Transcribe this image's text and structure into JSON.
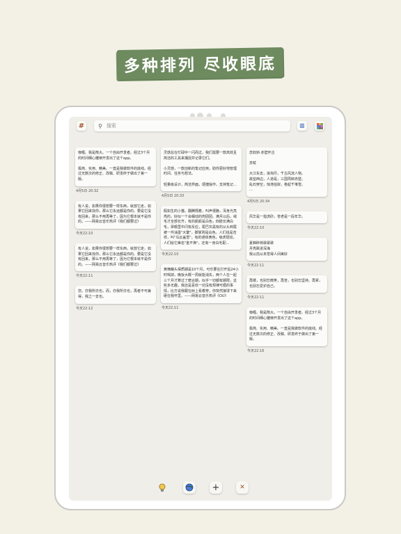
{
  "headline": "多种排列 尽收眼底",
  "search": {
    "placeholder": "搜索"
  },
  "toolbar": {
    "tag_icon": "#",
    "sort_icon": "≡",
    "color_icon": "■"
  },
  "columns": [
    [
      {
        "text": "咖喱。我是熊大。一个自由开发者。经过3个月的时间细心雕琢开发出了这个app。\n\n极简、实用、精美。一直是我做软件的底线。经过无数次的修正、改稿、研发终于做出了第一版。",
        "time": "4月5日 20:32"
      },
      {
        "text": "有人说，如果你很想要一样东西，就放它走，如果它回来找你，那么它永远都是你的。要是它没有回来，那么不用再等了，因为它根本就不是你的。——网易云音乐热评《我们都要过》",
        "time": "今天22:10"
      },
      {
        "text": "有人说，如果你很想要一样东西，就放它走，如果它回来找你，那么它永远都是你的。要是它没有回来，那么不用再等了，因为它根本就不是你的。——网易云音乐热评《我们都要过》",
        "time": "今天22:11"
      },
      {
        "text": "您。亦我所亦也，而，亦我所亦也，再者不可兼得，我之一去也。",
        "time": "今天22:12"
      }
    ],
    [
      {
        "text": "灵感总在忙碌中一闪而过，我们需要一款高效且简洁的工具来捕捉并记录它们。\n\n小灵感，一款创新的笔记应用，助你更好地管理时间、任务与想法。\n\n轻量级设计，简洁界面，便捷操作，支持笔记…",
        "time": "4月5日 20:33"
      },
      {
        "text": "假如生的小猫，翻腾翔着，叫声很脆，浑身光亮亮的，好似一个会蠕动的肉团团。满月以后，绒毛才全部长齐，有的颜颜是白色，四肢长满白毛，翠眼里中闪有反应，尾巴灰黑有的从头到尾被一件油墨\"大氅\"，脚掌则是白色。人们说是吉祥，叫\"乌云盖雪\"。有的通体黄色，吸虎斑纹，人们给它美名\"金不换\"。还有一身白毛配…",
        "time": "今天22:10"
      },
      {
        "text": "黄桷罐头保质期是10个月，可乐要在打开后24小时喝掉，晚饭大概一周就能消失，两个人在一起三个月才算过了磨合期，似乎一切都有期限，这些多无趣，我还是喜欢一切没有规律可循的事情，比方说我跟在树上看着穿，你突然接球下来砸在我怀里。——网易云音乐热评《OU》",
        "time": "今天22:11"
      }
    ],
    [
      {
        "text": "念奴娇·赤壁怀古\n\n苏轼\n\n大江东去，浪淘尽，千古风流人物。\n故垒西边，人道是，三国周郎赤壁。\n乱石穿空，惊涛拍岸，卷起千堆雪。\n…",
        "time": "4月5日 20:34"
      },
      {
        "text": "风华是一指流砂，苍老是一段年华。",
        "time": "今天22:10"
      },
      {
        "text": "夏蝉醉荷歌歌歌\n月亮跌进深海\n我以前从未觉得人间美好",
        "time": "今天22:11"
      },
      {
        "text": "再楼，也别忘微笑，再苦，也别忘坚持。再累，也别忘爱护自己。",
        "time": "今天22:11"
      },
      {
        "text": "咖喱。我是熊大。一个自由开发者。经过3个月的时间细心雕琢开发出了这个app。\n\n极简、实用、精美。一直是我做软件的底线。经过无数次的修正、改稿、研发终于做出了第一版。",
        "time": "今天22:16"
      }
    ]
  ],
  "bottom": {
    "bulb_icon": "💡",
    "globe_icon": "●",
    "add_icon": "+",
    "tools_icon": "✕"
  },
  "colors": {
    "headline_bg": "#6e8a5f",
    "background": "#f3f1e6"
  }
}
